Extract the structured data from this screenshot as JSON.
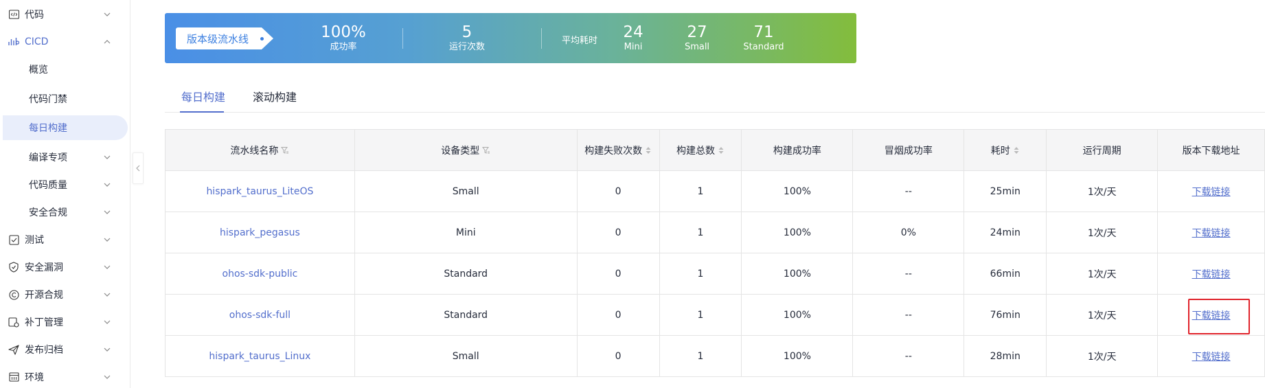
{
  "sidebar": {
    "items": [
      {
        "label": "代码",
        "icon": "code-icon",
        "expanded": false
      },
      {
        "label": "CICD",
        "icon": "cicd-icon",
        "expanded": true
      },
      {
        "label": "概览"
      },
      {
        "label": "代码门禁"
      },
      {
        "label": "每日构建",
        "selected": true
      },
      {
        "label": "编译专项"
      },
      {
        "label": "代码质量"
      },
      {
        "label": "安全合规"
      },
      {
        "label": "测试",
        "icon": "test-icon"
      },
      {
        "label": "安全漏洞",
        "icon": "shield-icon"
      },
      {
        "label": "开源合规",
        "icon": "copyright-icon"
      },
      {
        "label": "补丁管理",
        "icon": "patch-icon"
      },
      {
        "label": "发布归档",
        "icon": "send-icon"
      },
      {
        "label": "环境",
        "icon": "environment-icon"
      }
    ]
  },
  "banner": {
    "tag": "版本级流水线",
    "success_rate": "100%",
    "success_rate_label": "成功率",
    "run_count": "5",
    "run_count_label": "运行次数",
    "avg_label": "平均耗时",
    "mini_value": "24",
    "mini_label": "Mini",
    "small_value": "27",
    "small_label": "Small",
    "standard_value": "71",
    "standard_label": "Standard"
  },
  "tabs": [
    "每日构建",
    "滚动构建"
  ],
  "table": {
    "headers": [
      "流水线名称",
      "设备类型",
      "构建失败次数",
      "构建总数",
      "构建成功率",
      "冒烟成功率",
      "耗时",
      "运行周期",
      "版本下载地址"
    ],
    "rows": [
      [
        "hispark_taurus_LiteOS",
        "Small",
        "0",
        "1",
        "100%",
        "--",
        "25min",
        "1次/天",
        "下载链接"
      ],
      [
        "hispark_pegasus",
        "Mini",
        "0",
        "1",
        "100%",
        "0%",
        "24min",
        "1次/天",
        "下载链接"
      ],
      [
        "ohos-sdk-public",
        "Standard",
        "0",
        "1",
        "100%",
        "--",
        "66min",
        "1次/天",
        "下载链接"
      ],
      [
        "ohos-sdk-full",
        "Standard",
        "0",
        "1",
        "100%",
        "--",
        "76min",
        "1次/天",
        "下载链接"
      ],
      [
        "hispark_taurus_Linux",
        "Small",
        "0",
        "1",
        "100%",
        "--",
        "28min",
        "1次/天",
        "下载链接"
      ]
    ]
  },
  "colors": {
    "accent": "#526ecc",
    "highlight": "#e0222a"
  }
}
